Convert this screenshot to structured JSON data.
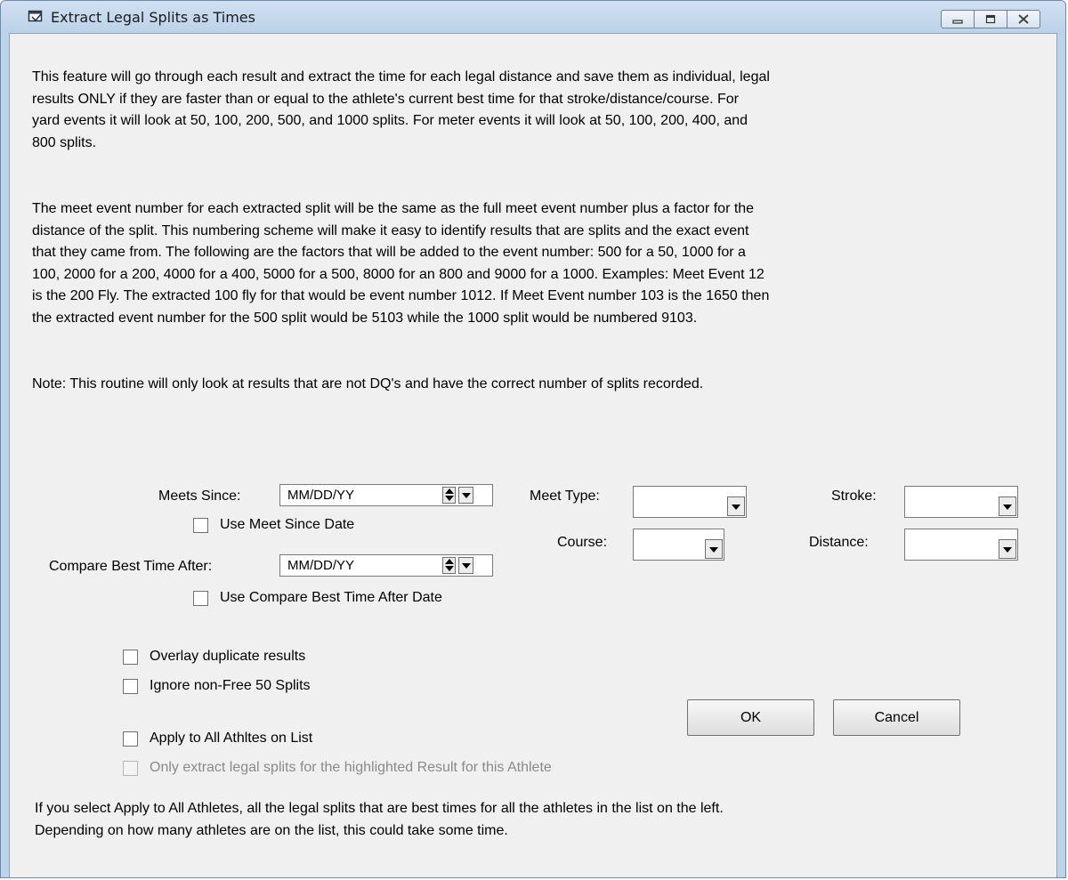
{
  "window": {
    "title": "Extract Legal Splits as Times",
    "icon": "dialog-window-icon",
    "controls": [
      "minimize-icon",
      "maximize-icon",
      "close-icon"
    ]
  },
  "description": {
    "para1": "This feature will go through each result and extract the time for each legal distance and save them as individual, legal\nresults ONLY if they are faster than or equal to the athlete's current best time for that stroke/distance/course.  For\nyard events it will look at 50, 100, 200, 500, and 1000 splits.   For meter events it will look at 50, 100, 200, 400, and\n800 splits.",
    "para2": "The meet event number for each extracted split will be the same as the full meet event number plus a factor for the\ndistance of the split.  This numbering scheme will make it easy to identify results that are splits and the exact event\nthat they came from.   The following are the factors that will be added to the event number: 500 for a 50, 1000 for a\n100, 2000 for a 200, 4000 for a 400, 5000 for a 500, 8000 for an 800 and 9000 for a 1000.  Examples: Meet Event 12\nis the 200 Fly.  The extracted 100 fly for that would be event number 1012.  If Meet Event number 103 is the 1650 then\nthe extracted event number for the 500 split would be 5103 while the 1000 split would be numbered 9103.",
    "note": "Note: This routine will only look at results that are not DQ's and have the correct number of splits recorded."
  },
  "filters": {
    "meets_since_label": "Meets Since:",
    "meets_since_value": "MM/DD/YY",
    "use_meet_since_label": "Use Meet Since Date",
    "compare_best_label": "Compare Best Time After:",
    "compare_best_value": "MM/DD/YY",
    "use_compare_best_label": "Use Compare Best Time After  Date",
    "meet_type_label": "Meet Type:",
    "meet_type_value": "",
    "course_label": "Course:",
    "course_value": "",
    "stroke_label": "Stroke:",
    "stroke_value": "",
    "distance_label": "Distance:",
    "distance_value": ""
  },
  "options": {
    "overlay_label": "Overlay duplicate results",
    "ignore_label": "Ignore non-Free 50 Splits",
    "apply_all_label": "Apply to All Athltes on List",
    "only_highlighted_label": "Only extract legal splits for the highlighted Result for this Athlete"
  },
  "buttons": {
    "ok": "OK",
    "cancel": "Cancel"
  },
  "footer_note": "If you select Apply to All Athletes, all the legal splits that are best times for all the athletes in the list on the left.\nDepending on how many athletes are on the list, this could take some time."
}
